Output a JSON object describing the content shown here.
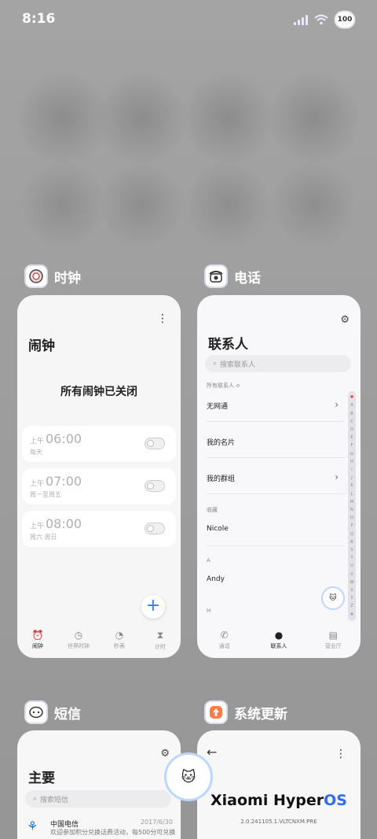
{
  "status_bar": {
    "time": "8:16",
    "battery": "100"
  },
  "clock_app": {
    "name": "时钟",
    "title": "闹钟",
    "empty_message": "所有闹钟已关闭",
    "alarms": [
      {
        "ampm": "上午",
        "time": "06:00",
        "repeat": "每天",
        "enabled": false
      },
      {
        "ampm": "上午",
        "time": "07:00",
        "repeat": "周一至周五",
        "enabled": false
      },
      {
        "ampm": "上午",
        "time": "08:00",
        "repeat": "周六 周日",
        "enabled": false
      }
    ],
    "add_glyph": "+",
    "nav": [
      {
        "label": "闹钟",
        "icon": "alarm-icon",
        "active": true
      },
      {
        "label": "世界时钟",
        "icon": "globe-clock-icon",
        "active": false
      },
      {
        "label": "秒表",
        "icon": "stopwatch-icon",
        "active": false
      },
      {
        "label": "计时",
        "icon": "hourglass-icon",
        "active": false
      }
    ]
  },
  "phone_app": {
    "name": "电话",
    "title": "联系人",
    "search_placeholder": "搜索联系人",
    "all_contacts_label": "所有联系人 ≎",
    "rows": [
      {
        "label": "无网通",
        "chevron": true
      },
      {
        "label": "我的名片",
        "chevron": false
      },
      {
        "label": "我的群组",
        "chevron": true
      }
    ],
    "favorites_label": "收藏",
    "favorite_contact": "Nicole",
    "section_a": "A",
    "contact_a": "Andy",
    "section_h": "H",
    "alphabet": [
      "♥",
      "A",
      "B",
      "C",
      "D",
      "E",
      "F",
      "G",
      "H",
      "I",
      "J",
      "K",
      "L",
      "M",
      "N",
      "O",
      "P",
      "Q",
      "R",
      "S",
      "T",
      "U",
      "V",
      "W",
      "X",
      "Y",
      "Z",
      "#"
    ],
    "nav": [
      {
        "label": "通话",
        "icon": "phone-icon",
        "active": false
      },
      {
        "label": "联系人",
        "icon": "person-icon",
        "active": true
      },
      {
        "label": "营业厅",
        "icon": "store-icon",
        "active": false
      }
    ]
  },
  "messages_app": {
    "name": "短信",
    "title": "主要",
    "search_placeholder": "搜索短信",
    "message": {
      "sender": "中国电信",
      "date": "2017/6/30",
      "preview": "欢迎参加积分兑换话费活动，每500分可兑换"
    }
  },
  "update_app": {
    "name": "系统更新",
    "os_name_main": "Xiaomi Hyper",
    "os_name_accent": "OS",
    "version": "2.0.241105.1.VLTCNXM.PRE"
  },
  "colors": {
    "accent": "#2d6bff",
    "background": "#9e9e9e"
  }
}
